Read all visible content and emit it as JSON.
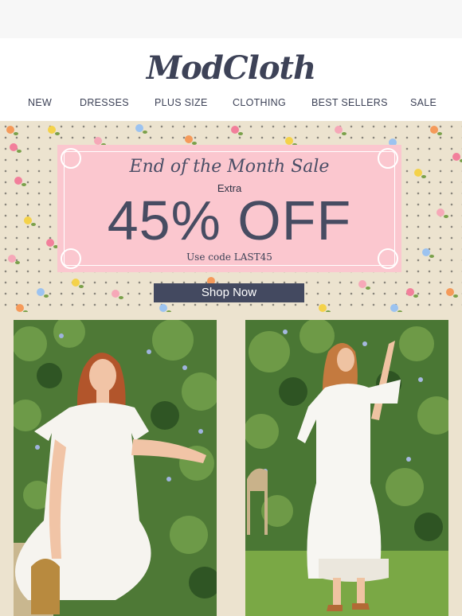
{
  "brand": {
    "logo": "ModCloth"
  },
  "nav": {
    "items": [
      "NEW",
      "DRESSES",
      "PLUS SIZE",
      "CLOTHING",
      "BEST SELLERS",
      "SALE"
    ]
  },
  "banner": {
    "title": "End of the Month Sale",
    "extra": "Extra",
    "discount": "45% OFF",
    "code_text": "Use code LAST45",
    "cta": "Shop Now"
  },
  "colors": {
    "navy": "#434960",
    "pink": "#fbc7cf",
    "cream": "#ece3cf",
    "text": "#3d4257"
  },
  "products": [
    {
      "image": "model-white-flutter-sleeve-dress-photo"
    },
    {
      "image": "model-white-eyelet-midi-dress-photo"
    }
  ]
}
